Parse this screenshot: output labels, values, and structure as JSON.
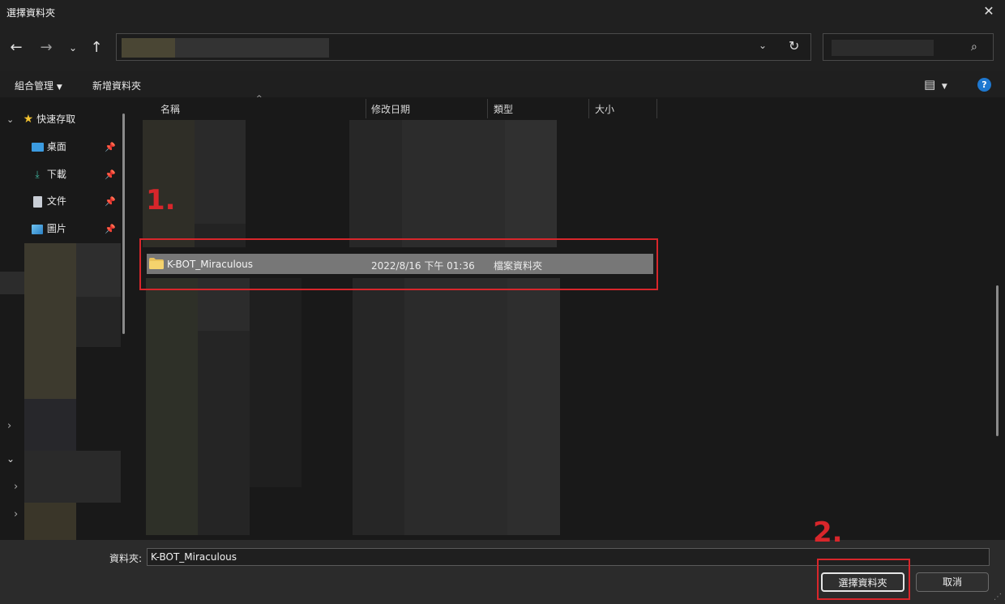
{
  "window": {
    "title": "選擇資料夾",
    "close_icon": "close-icon"
  },
  "nav": {
    "back_icon": "arrow-left-icon",
    "forward_icon": "arrow-right-icon",
    "recent_icon": "chevron-down-icon",
    "up_icon": "arrow-up-icon",
    "refresh_icon": "refresh-icon",
    "search_icon": "search-icon"
  },
  "toolbar": {
    "organize_label": "組合管理",
    "new_folder_label": "新增資料夾"
  },
  "sidebar": {
    "quick_access": "快速存取",
    "items": [
      {
        "label": "桌面",
        "icon": "desktop-icon"
      },
      {
        "label": "下載",
        "icon": "download-icon"
      },
      {
        "label": "文件",
        "icon": "document-icon"
      },
      {
        "label": "圖片",
        "icon": "pictures-icon"
      }
    ]
  },
  "columns": {
    "name": "名稱",
    "modified": "修改日期",
    "type": "類型",
    "size": "大小"
  },
  "selected_row": {
    "name": "K-BOT_Miraculous",
    "modified": "2022/8/16 下午 01:36",
    "type": "檔案資料夾"
  },
  "annotations": {
    "step1": "1.",
    "step2": "2."
  },
  "footer": {
    "folder_label": "資料夾:",
    "folder_value": "K-BOT_Miraculous",
    "select_button": "選擇資料夾",
    "cancel_button": "取消"
  },
  "colors": {
    "annotation_red": "#d8262b",
    "selection_gray": "#777777",
    "help_blue": "#1e78d0",
    "folder_yellow": "#e8c15a"
  }
}
